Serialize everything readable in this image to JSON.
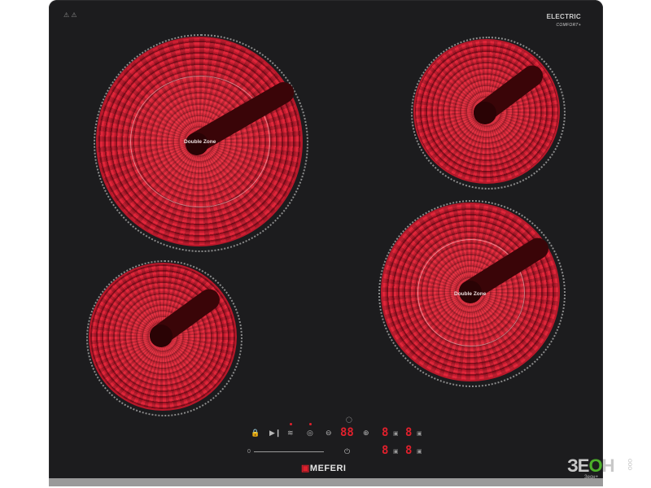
{
  "product": {
    "type_label": "ELECTRIC",
    "type_sublabel": "COMFORT+",
    "brand": "MEFERI",
    "warning_symbols": "⚠ ⚠"
  },
  "zones": [
    {
      "position": "top-left",
      "label": "Double Zone"
    },
    {
      "position": "top-right",
      "label": ""
    },
    {
      "position": "bottom-left",
      "label": ""
    },
    {
      "position": "bottom-right",
      "label": "Double Zone"
    }
  ],
  "control_panel": {
    "icons": [
      "lock-icon",
      "pause-icon",
      "keep-warm-icon",
      "dual-zone-icon",
      "minus-icon",
      "plus-icon",
      "timer-icon",
      "power-icon"
    ],
    "timer_display": "88",
    "zone_displays": [
      "8",
      "8",
      "8",
      "8"
    ],
    "slider_min": "0",
    "colors": {
      "display": "#e0202c",
      "glass": "#1c1c1e",
      "zone": "#c41b2e"
    }
  },
  "watermark": {
    "text_left": "ЗЕ",
    "text_o": "О",
    "text_right": "Н",
    "sub": "Зеон+",
    "side": "ООО"
  }
}
